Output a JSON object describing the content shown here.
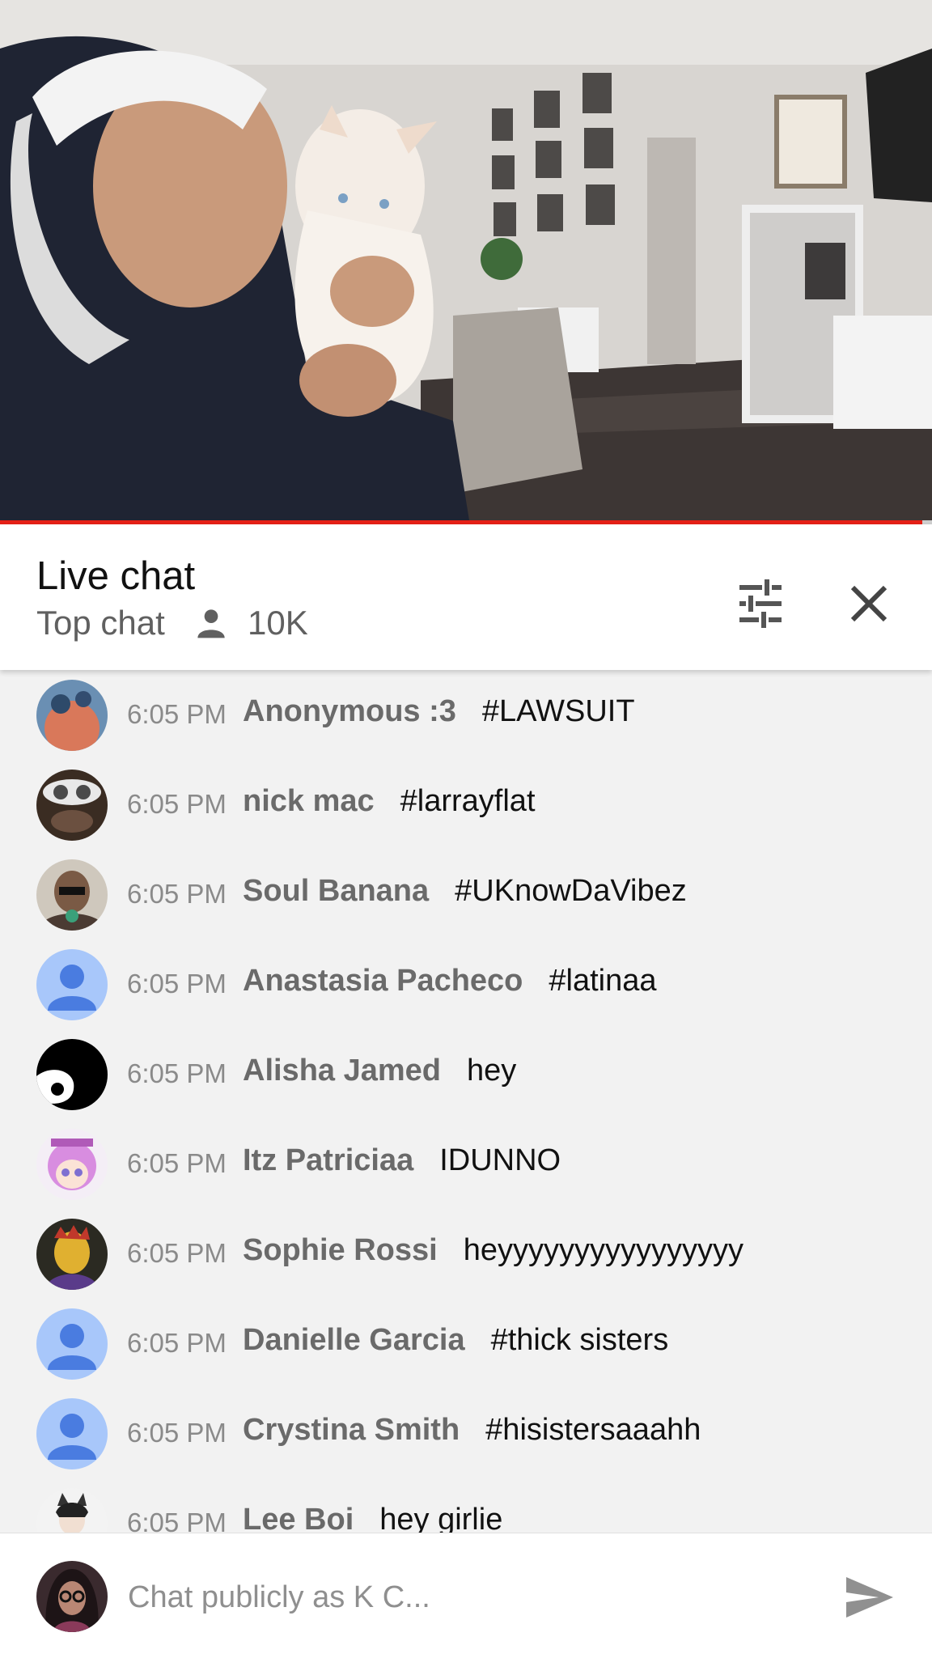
{
  "video": {
    "description_icon": "video-frame",
    "progress": 0.99
  },
  "header": {
    "title": "Live chat",
    "mode": "Top chat",
    "viewer_count": "10K"
  },
  "messages": [
    {
      "time": "6:05 PM",
      "author": "Anonymous :3",
      "text": "#LAWSUIT",
      "avatar": "photo"
    },
    {
      "time": "6:05 PM",
      "author": "nick mac",
      "text": "#larrayflat",
      "avatar": "photo"
    },
    {
      "time": "6:05 PM",
      "author": "Soul Banana",
      "text": "#UKnowDaVibez",
      "avatar": "photo"
    },
    {
      "time": "6:05 PM",
      "author": "Anastasia Pacheco",
      "text": "#latinaa",
      "avatar": "default"
    },
    {
      "time": "6:05 PM",
      "author": "Alisha Jamed",
      "text": "hey",
      "avatar": "photo"
    },
    {
      "time": "6:05 PM",
      "author": "Itz Patriciaa",
      "text": "IDUNNO",
      "avatar": "photo"
    },
    {
      "time": "6:05 PM",
      "author": "Sophie Rossi",
      "text": "heyyyyyyyyyyyyyyyy",
      "avatar": "photo"
    },
    {
      "time": "6:05 PM",
      "author": "Danielle Garcia",
      "text": "#thick sisters",
      "avatar": "default"
    },
    {
      "time": "6:05 PM",
      "author": "Crystina Smith",
      "text": "#hisistersaaahh",
      "avatar": "default"
    },
    {
      "time": "6:05 PM",
      "author": "Lee Boi",
      "text": "hey girlie",
      "avatar": "photo"
    }
  ],
  "input": {
    "placeholder": "Chat publicly as K C..."
  },
  "colors": {
    "progress": "#e62117",
    "default_avatar_bg": "#a8c7fa",
    "default_avatar_fg": "#4a7ce0"
  }
}
